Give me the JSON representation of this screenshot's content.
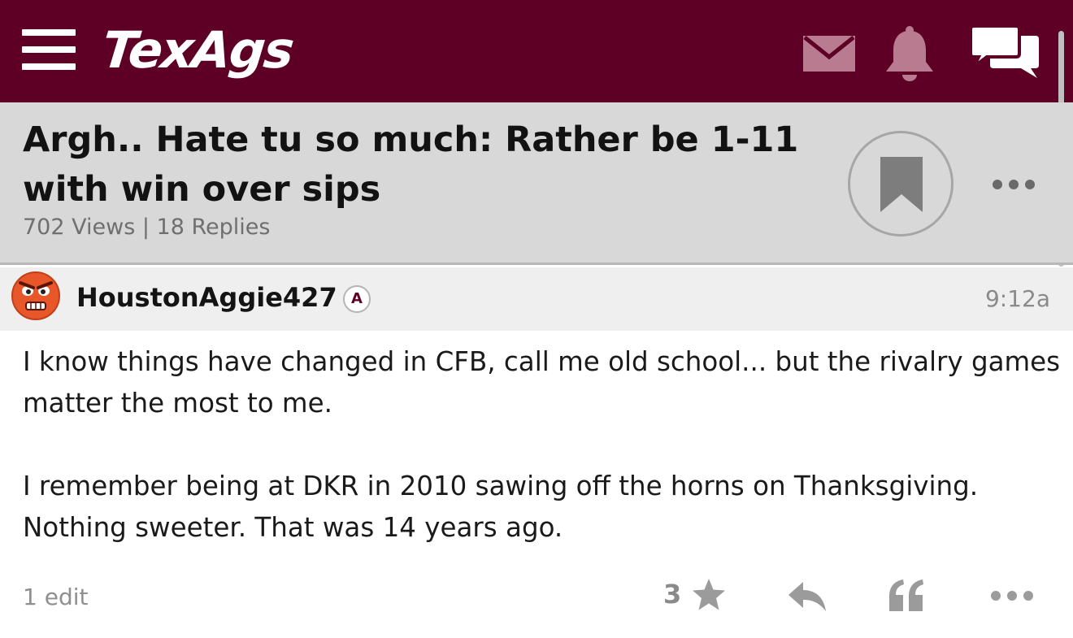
{
  "header": {
    "logo_text": "TexAgs",
    "icons": [
      "menu-icon",
      "mail-icon",
      "bell-icon",
      "chat-icon"
    ],
    "brand_color": "#5e0026"
  },
  "thread": {
    "title": "Argh.. Hate tu so much: Rather be 1-11 with win over sips",
    "meta": "702 Views | 18 Replies"
  },
  "post": {
    "username": "HoustonAggie427",
    "badge": "A",
    "time": "9:12a",
    "paragraphs": [
      "I know things have changed in CFB, call me old school... but the rivalry games matter the most to me.",
      "I remember being at DKR in 2010 sawing off the horns on Thanksgiving. Nothing sweeter. That was 14 years ago."
    ],
    "edit_count": "1 edit",
    "like_count": "3"
  }
}
